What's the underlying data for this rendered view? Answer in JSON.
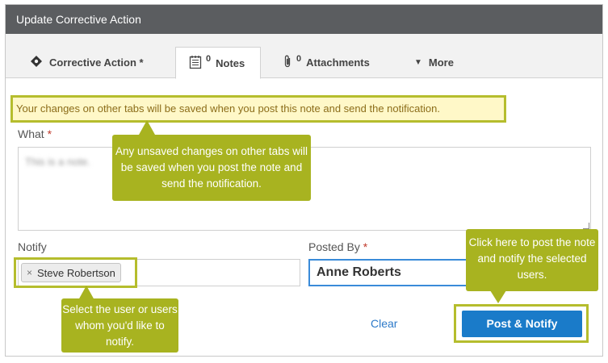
{
  "dialog": {
    "title": "Update Corrective Action"
  },
  "tabs": [
    {
      "label": "Corrective Action *",
      "icon": "diamond-icon"
    },
    {
      "count": "0",
      "label": "Notes",
      "icon": "notes-icon"
    },
    {
      "count": "0",
      "label": "Attachments",
      "icon": "paperclip-icon"
    },
    {
      "label": "More",
      "icon": "caret-down-icon"
    }
  ],
  "notice": "Your changes on other tabs will be saved when you post this note and send the notification.",
  "what": {
    "label": "What",
    "required": "*",
    "value": "This is a note."
  },
  "notify": {
    "label": "Notify",
    "chip_remove": "×",
    "chip_label": "Steve Robertson"
  },
  "posted_by": {
    "label": "Posted By",
    "required": "*",
    "value": "Anne Roberts"
  },
  "actions": {
    "clear": "Clear",
    "post": "Post & Notify"
  },
  "callouts": {
    "unsaved": "Any unsaved changes on other tabs will be saved when you post the note and send the notification.",
    "select_user": "Select the user or users whom you'd like to notify.",
    "post_hint": "Click here to post the note and notify the selected users."
  },
  "colors": {
    "titlebar": "#5b5d60",
    "callout": "#a8b320",
    "highlight": "#b5bd2d",
    "primary": "#1a7bc9",
    "notice_bg": "#fff8c8"
  }
}
